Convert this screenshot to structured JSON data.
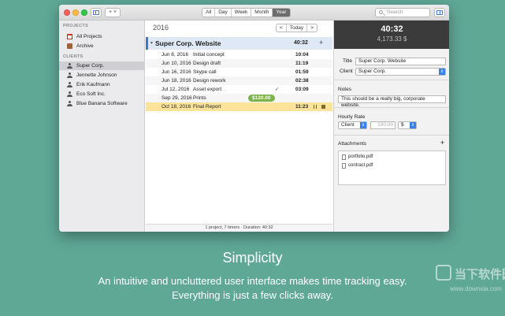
{
  "toolbar": {
    "add_label": "+ ˅",
    "segments": [
      "All",
      "Day",
      "Week",
      "Month",
      "Year"
    ],
    "active_segment": "Year",
    "search_placeholder": "Search"
  },
  "sidebar": {
    "projects_header": "PROJECTS",
    "projects": [
      {
        "label": "All Projects",
        "icon": "calendar-icon"
      },
      {
        "label": "Archive",
        "icon": "archive-icon"
      }
    ],
    "clients_header": "CLIENTS",
    "clients": [
      {
        "label": "Super Corp.",
        "selected": true
      },
      {
        "label": "Jennette Johnson"
      },
      {
        "label": "Erik Kaufmann"
      },
      {
        "label": "Eco Soft Inc."
      },
      {
        "label": "Blue Banana Software"
      }
    ]
  },
  "main": {
    "year": "2016",
    "nav_prev": "<",
    "nav_today": "Today",
    "nav_next": ">",
    "project": {
      "name": "Super Corp. Website",
      "duration": "40:32",
      "add": "+"
    },
    "timers": [
      {
        "date": "Jun 8, 2016",
        "name": "Initial concept",
        "duration": "10:04"
      },
      {
        "date": "Jun 10, 2016",
        "name": "Design draft",
        "duration": "11:19"
      },
      {
        "date": "Jun 16, 2016",
        "name": "Skype call",
        "duration": "01:59"
      },
      {
        "date": "Jun 18, 2016",
        "name": "Design rework",
        "duration": "02:38"
      },
      {
        "date": "Jul 12, 2016",
        "name": "Asset export",
        "duration": "03:09",
        "check": "✓"
      },
      {
        "date": "Sep 29, 2016",
        "name": "Prints",
        "badge": "$120.00"
      },
      {
        "date": "Oct 18, 2016",
        "name": "Final Report",
        "duration": "11:23",
        "active": true
      }
    ],
    "footer": "1 project, 7 timers  ·  Duration: 40:32"
  },
  "inspector": {
    "time": "40:32",
    "amount": "4,173.33 $",
    "title_label": "Title",
    "title_value": "Super Corp. Website",
    "client_label": "Client",
    "client_value": "Super Corp.",
    "notes_label": "Notes",
    "notes_value": "This should be a really big, corporate website.",
    "hourly_label": "Hourly Rate",
    "rate_type": "Client",
    "rate_value": "100.00",
    "currency": "$",
    "attachments_label": "Attachments",
    "attachments_add": "+",
    "attachments": [
      "portfolio.pdf",
      "contract.pdf"
    ]
  },
  "caption": {
    "title": "Simplicity",
    "line1": "An intuitive and uncluttered user interface makes time tracking easy.",
    "line2": "Everything is just a few clicks away."
  },
  "watermark": {
    "text": "当下软件园",
    "url": "www.downxia.com"
  }
}
